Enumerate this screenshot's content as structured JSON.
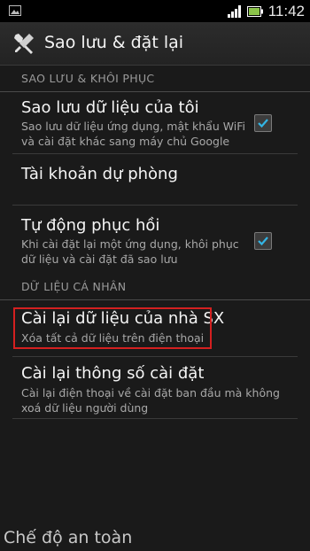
{
  "status_bar": {
    "time": "11:42"
  },
  "action_bar": {
    "title": "Sao lưu & đặt lại"
  },
  "sections": {
    "backup": "SAO LƯU & KHÔI PHỤC",
    "personal": "DỮ LIỆU CÁ NHÂN"
  },
  "items": {
    "backup_data": {
      "title": "Sao lưu dữ liệu của tôi",
      "summary": "Sao lưu dữ liệu ứng dụng, mật khẩu WiFi và cài đặt khác sang máy chủ Google",
      "checked": true
    },
    "backup_account": {
      "title": "Tài khoản dự phòng"
    },
    "auto_restore": {
      "title": "Tự động phục hồi",
      "summary": "Khi cài đặt lại một ứng dụng, khôi phục dữ liệu và cài đặt đã sao lưu",
      "checked": true
    },
    "factory_reset": {
      "title": "Cài lại dữ liệu của nhà SX",
      "summary": "Xóa tất cả dữ liệu trên điện thoại"
    },
    "reset_settings": {
      "title": "Cài lại thông số cài đặt",
      "summary": "Cài lại điện thoại về cài đặt ban đầu mà không xoá dữ liệu người dùng"
    }
  },
  "safe_mode_label": "Chế độ an toàn",
  "colors": {
    "highlight_border": "#d42020",
    "checkmark": "#33b5e5"
  }
}
